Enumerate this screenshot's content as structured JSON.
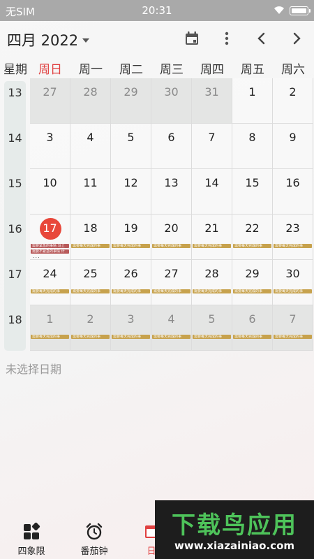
{
  "status_bar": {
    "carrier": "无SIM",
    "time": "20:31"
  },
  "header": {
    "title": "四月 2022"
  },
  "week_header": [
    "星期",
    "周日",
    "周一",
    "周二",
    "周三",
    "周四",
    "周五",
    "周六"
  ],
  "weeks": [
    {
      "week": "13",
      "days": [
        {
          "d": "27",
          "other": true
        },
        {
          "d": "28",
          "other": true
        },
        {
          "d": "29",
          "other": true
        },
        {
          "d": "30",
          "other": true
        },
        {
          "d": "31",
          "other": true
        },
        {
          "d": "1"
        },
        {
          "d": "2"
        }
      ]
    },
    {
      "week": "14",
      "days": [
        {
          "d": "3"
        },
        {
          "d": "4"
        },
        {
          "d": "5"
        },
        {
          "d": "6"
        },
        {
          "d": "7"
        },
        {
          "d": "8"
        },
        {
          "d": "9"
        }
      ]
    },
    {
      "week": "15",
      "days": [
        {
          "d": "10"
        },
        {
          "d": "11"
        },
        {
          "d": "12"
        },
        {
          "d": "13"
        },
        {
          "d": "14"
        },
        {
          "d": "15"
        },
        {
          "d": "16"
        }
      ]
    },
    {
      "week": "16",
      "days": [
        {
          "d": "17",
          "today": true,
          "events": [
            {
              "t": "需要紧急的事情 马上",
              "c": "red"
            },
            {
              "t": "需要不紧急的事情 计",
              "c": "red"
            }
          ],
          "more": "..."
        },
        {
          "d": "18",
          "events": [
            {
              "t": "需要每天完成的事",
              "c": "gold"
            }
          ]
        },
        {
          "d": "19",
          "events": [
            {
              "t": "需要每天完成的事",
              "c": "gold"
            }
          ]
        },
        {
          "d": "20",
          "events": [
            {
              "t": "需要每天完成的事",
              "c": "gold"
            }
          ]
        },
        {
          "d": "21",
          "events": [
            {
              "t": "需要每天完成的事",
              "c": "gold"
            }
          ]
        },
        {
          "d": "22",
          "events": [
            {
              "t": "需要每天完成的事",
              "c": "gold"
            }
          ]
        },
        {
          "d": "23",
          "events": [
            {
              "t": "需要每天完成的事",
              "c": "gold"
            }
          ]
        }
      ]
    },
    {
      "week": "17",
      "days": [
        {
          "d": "24",
          "events": [
            {
              "t": "需要每天完成的事",
              "c": "gold"
            }
          ]
        },
        {
          "d": "25",
          "events": [
            {
              "t": "需要每天完成的事",
              "c": "gold"
            }
          ]
        },
        {
          "d": "26",
          "events": [
            {
              "t": "需要每天完成的事",
              "c": "gold"
            }
          ]
        },
        {
          "d": "27",
          "events": [
            {
              "t": "需要每天完成的事",
              "c": "gold"
            }
          ]
        },
        {
          "d": "28",
          "events": [
            {
              "t": "需要每天完成的事",
              "c": "gold"
            }
          ]
        },
        {
          "d": "29",
          "events": [
            {
              "t": "需要每天完成的事",
              "c": "gold"
            }
          ]
        },
        {
          "d": "30",
          "events": [
            {
              "t": "需要每天完成的事",
              "c": "gold"
            }
          ]
        }
      ]
    },
    {
      "week": "18",
      "days": [
        {
          "d": "1",
          "other": true,
          "events": [
            {
              "t": "需要每天完成的事",
              "c": "gold"
            }
          ]
        },
        {
          "d": "2",
          "other": true,
          "events": [
            {
              "t": "需要每天完成的事",
              "c": "gold"
            }
          ]
        },
        {
          "d": "3",
          "other": true,
          "events": [
            {
              "t": "需要每天完成的事",
              "c": "gold"
            }
          ]
        },
        {
          "d": "4",
          "other": true,
          "events": [
            {
              "t": "需要每天完成的事",
              "c": "gold"
            }
          ]
        },
        {
          "d": "5",
          "other": true,
          "events": [
            {
              "t": "需要每天完成的事",
              "c": "gold"
            }
          ]
        },
        {
          "d": "6",
          "other": true,
          "events": [
            {
              "t": "需要每天完成的事",
              "c": "gold"
            }
          ]
        },
        {
          "d": "7",
          "other": true,
          "events": [
            {
              "t": "需要每天完成的事",
              "c": "gold"
            }
          ]
        }
      ]
    }
  ],
  "no_date_text": "未选择日期",
  "bottom_nav": [
    {
      "label": "四象限",
      "icon": "quadrant-icon"
    },
    {
      "label": "番茄钟",
      "icon": "alarm-clock-icon"
    },
    {
      "label": "日",
      "icon": "calendar-icon"
    }
  ],
  "watermark": {
    "title": "下载鸟应用",
    "url": "www.xiazainiao.com"
  },
  "colors": {
    "today": "#e8473a",
    "sunday": "#e04040",
    "event_gold": "#c7a24d",
    "event_red": "#b85a5a",
    "status_bar": "#a9a9a9"
  }
}
